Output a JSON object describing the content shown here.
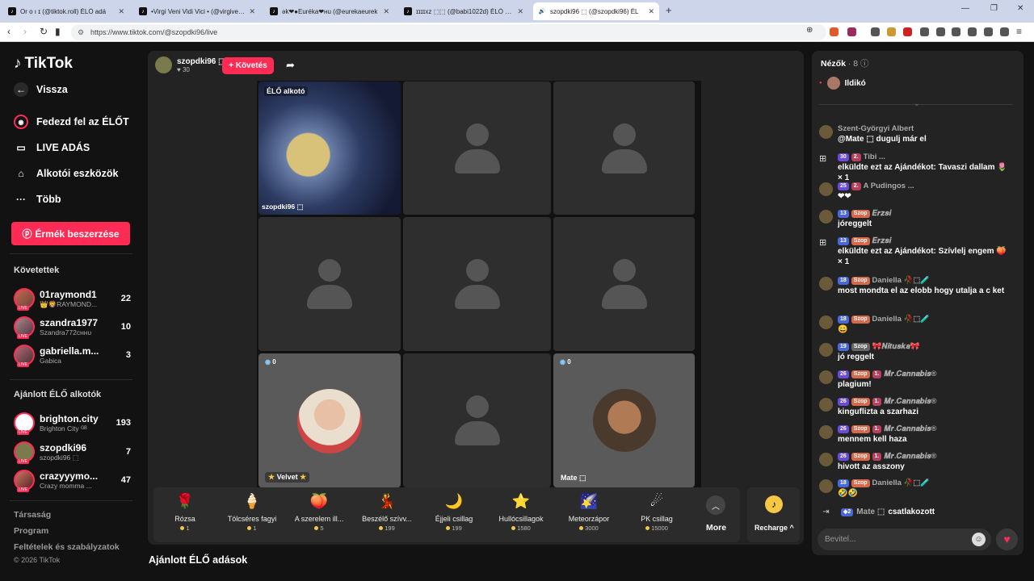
{
  "browser": {
    "tabs": [
      {
        "title": "Or o ı ɪ (@tiktok.roll) ÉLŐ adá"
      },
      {
        "title": "•Virgi Veni Vidi Vici • (@virgivenividi"
      },
      {
        "title": "ǝk❤︎●Euréka❤︎ʜu (@eurekaeurek"
      },
      {
        "title": "ɪɪɪɪxz ⬚⬚ (@babi1022d) ÉLŐ adásba"
      },
      {
        "title": "szopdki96 ⬚ (@szopdki96) ÉL"
      }
    ],
    "url": "https://www.tiktok.com/@szopdki96/live"
  },
  "sidebar": {
    "logo": "TikTok",
    "back": "Vissza",
    "menu": [
      "Fedezd fel az ÉLŐT",
      "LIVE ADÁS",
      "Alkotói eszközök",
      "Több"
    ],
    "coins_button": "Érmék beszerzése",
    "followed_header": "Követettek",
    "followed": [
      {
        "name": "01raymond1",
        "sub": "👑🦁RAYMOND...",
        "count": "22"
      },
      {
        "name": "szandra1977",
        "sub": "Szandra772ᴄʜʜᴜ",
        "count": "10"
      },
      {
        "name": "gabriella.m...",
        "sub": "Gabica",
        "count": "3"
      }
    ],
    "suggested_header": "Ajánlott ÉLŐ alkotók",
    "suggested": [
      {
        "name": "brighton.city",
        "sub": "Brighton City ᴳᴮ",
        "count": "193"
      },
      {
        "name": "szopdki96",
        "sub": "szopdki96 ⬚",
        "count": "7"
      },
      {
        "name": "crazyyymo...",
        "sub": "Crazy momma ...",
        "count": "47"
      }
    ],
    "footer": [
      "Társaság",
      "Program",
      "Feltételek és szabályzatok",
      "© 2026 TikTok"
    ]
  },
  "stream": {
    "host": "szopdki96 ⬚",
    "host_likes": "30",
    "follow": "+ Követés",
    "creator_label": "ÉLŐ alkotó",
    "host_tile_name": "szopdki96 ⬚",
    "guests": [
      {
        "name": "Velvet",
        "count": "0"
      },
      {
        "name": "Mate ⬚",
        "count": "0"
      }
    ]
  },
  "gifts": [
    {
      "name": "Rózsa",
      "price": "1",
      "icon": "🌹"
    },
    {
      "name": "Tölcséres fagyi",
      "price": "1",
      "icon": "🍦"
    },
    {
      "name": "A szerelem ill...",
      "price": "5",
      "icon": "🍑"
    },
    {
      "name": "Beszélő szívv...",
      "price": "199",
      "icon": "💃"
    },
    {
      "name": "Éjjeli csillag",
      "price": "199",
      "icon": "🌙"
    },
    {
      "name": "Hullócsillagok",
      "price": "1580",
      "icon": "⭐"
    },
    {
      "name": "Meteorzápor",
      "price": "3000",
      "icon": "🌠"
    },
    {
      "name": "PK csillag",
      "price": "15000",
      "icon": "☄"
    }
  ],
  "more_label": "More",
  "recharge_label": "Recharge",
  "bottom_header": "Ajánlott ÉLŐ adások",
  "chat": {
    "viewers_label": "Nézők",
    "viewers_count": "· 8",
    "top_viewer": "Ildikó",
    "messages": [
      {
        "user": "Szent-Györgyi Albert",
        "badges": [],
        "text": "@Mate ⬚ dugulj már el"
      },
      {
        "user": "Tibi ...",
        "badges": [
          {
            "t": "30",
            "c": "b-lv"
          },
          {
            "t": "2.",
            "c": "b-rk"
          }
        ],
        "text": "elküldte ezt az Ajándékot: Tavaszi dallam 🌷 × 1",
        "gift": true
      },
      {
        "user": "A Pudingos ...",
        "badges": [
          {
            "t": "25",
            "c": "b-lv"
          },
          {
            "t": "2.",
            "c": "b-rk"
          }
        ],
        "text": "❤❤"
      },
      {
        "user": "𝑬𝒓𝒛𝒔𝒊",
        "badges": [
          {
            "t": "13",
            "c": "b-lvb"
          },
          {
            "t": "Szop",
            "c": "b-sz"
          }
        ],
        "text": "jóreggelt"
      },
      {
        "user": "𝑬𝒓𝒛𝒔𝒊",
        "badges": [
          {
            "t": "13",
            "c": "b-lvb"
          },
          {
            "t": "Szop",
            "c": "b-sz"
          }
        ],
        "text": "elküldte ezt az Ajándékot: Szívlelj engem 🍑 × 1",
        "gift": true
      },
      {
        "user": "Daniella 🥀⬚🧪",
        "badges": [
          {
            "t": "18",
            "c": "b-lvb"
          },
          {
            "t": "Szop",
            "c": "b-sz"
          }
        ],
        "text": "most mondta el az elobb hogy utalja a c ket"
      },
      {
        "user": "Daniella 🥀⬚🧪",
        "badges": [
          {
            "t": "18",
            "c": "b-lvb"
          },
          {
            "t": "Szop",
            "c": "b-sz"
          }
        ],
        "text": "😄"
      },
      {
        "user": "🎀𝑵𝒊𝒕𝒖𝒔𝒌𝒂🎀",
        "badges": [
          {
            "t": "19",
            "c": "b-lvb"
          },
          {
            "t": "Szop",
            "c": "b-sg"
          }
        ],
        "text": "jó reggelt"
      },
      {
        "user": "𝑴𝒓.𝑪𝒂𝒏𝒏𝒂𝒃𝒊𝒔®",
        "badges": [
          {
            "t": "26",
            "c": "b-lv"
          },
          {
            "t": "Szop",
            "c": "b-sz"
          },
          {
            "t": "1.",
            "c": "b-rk"
          }
        ],
        "text": "plagium!"
      },
      {
        "user": "𝑴𝒓.𝑪𝒂𝒏𝒏𝒂𝒃𝒊𝒔®",
        "badges": [
          {
            "t": "26",
            "c": "b-lv"
          },
          {
            "t": "Szop",
            "c": "b-sz"
          },
          {
            "t": "1.",
            "c": "b-rk"
          }
        ],
        "text": "kingufliztа a szarhazi"
      },
      {
        "user": "𝑴𝒓.𝑪𝒂𝒏𝒏𝒂𝒃𝒊𝒔®",
        "badges": [
          {
            "t": "26",
            "c": "b-lv"
          },
          {
            "t": "Szop",
            "c": "b-sz"
          },
          {
            "t": "1.",
            "c": "b-rk"
          }
        ],
        "text": "mennem kell haza"
      },
      {
        "user": "𝑴𝒓.𝑪𝒂𝒏𝒏𝒂𝒃𝒊𝒔®",
        "badges": [
          {
            "t": "26",
            "c": "b-lv"
          },
          {
            "t": "Szop",
            "c": "b-sz"
          },
          {
            "t": "1.",
            "c": "b-rk"
          }
        ],
        "text": "hivott az asszony"
      },
      {
        "user": "Daniella 🥀⬚🧪",
        "badges": [
          {
            "t": "18",
            "c": "b-lvb"
          },
          {
            "t": "Szop",
            "c": "b-sz"
          }
        ],
        "text": "🤣🤣"
      }
    ],
    "join": {
      "user": "Mate ⬚",
      "level": "2",
      "text": "csatlakozott"
    },
    "input_placeholder": "Bevitel..."
  }
}
